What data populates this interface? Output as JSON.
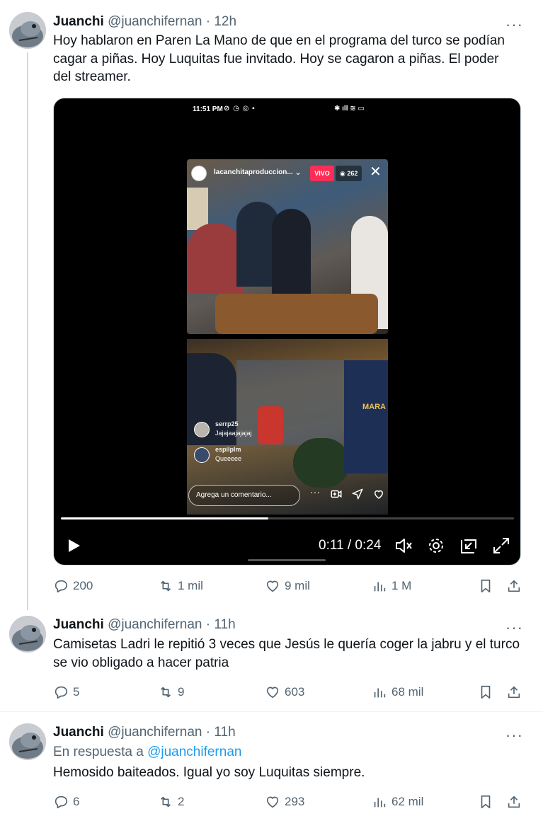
{
  "tweets": [
    {
      "name": "Juanchi",
      "handle": "@juanchifernan",
      "time": "· 12h",
      "more": "···",
      "text": "Hoy hablaron en Paren La Mano de que en el programa del turco se podían cagar a piñas. Hoy Luquitas fue invitado. Hoy se cagaron a piñas. El poder del streamer.",
      "replies": "200",
      "retweets": "1 mil",
      "likes": "9 mil",
      "views": "1 M"
    },
    {
      "name": "Juanchi",
      "handle": "@juanchifernan",
      "time": "· 11h",
      "more": "···",
      "text": "Camisetas Ladri le repitió 3 veces que Jesús le quería coger la jabru y el turco se vio obligado a hacer patria",
      "replies": "5",
      "retweets": "9",
      "likes": "603",
      "views": "68 mil"
    },
    {
      "name": "Juanchi",
      "handle": "@juanchifernan",
      "time": "· 11h",
      "more": "···",
      "reply_prefix": "En respuesta a",
      "reply_mention": "@juanchifernan",
      "text": "Hemosido baiteados. Igual yo soy  Luquitas siempre.",
      "replies": "6",
      "retweets": "2",
      "likes": "293",
      "views": "62 mil"
    }
  ],
  "video": {
    "status_time": "11:51 PM",
    "live_username": "lacanchitaproduccion...",
    "live_badge": "VIVO",
    "viewer_count": "262",
    "poster_text": "MARA",
    "comments": [
      {
        "user": "serrp25",
        "text": "Jajajaajajajaj"
      },
      {
        "user": "espilplm",
        "text": "Queeeee"
      }
    ],
    "comment_placeholder": "Agrega un comentario...",
    "time_display": "0:11 / 0:24",
    "progress_fraction": 0.458
  },
  "colors": {
    "accent": "#1d9bf0",
    "text_secondary": "#536471",
    "live_red": "#ff2d55"
  },
  "icons": [
    "reply-icon",
    "retweet-icon",
    "like-icon",
    "views-icon",
    "bookmark-icon",
    "share-icon",
    "play-icon",
    "volume-icon",
    "settings-icon",
    "pip-icon",
    "fullscreen-icon"
  ]
}
